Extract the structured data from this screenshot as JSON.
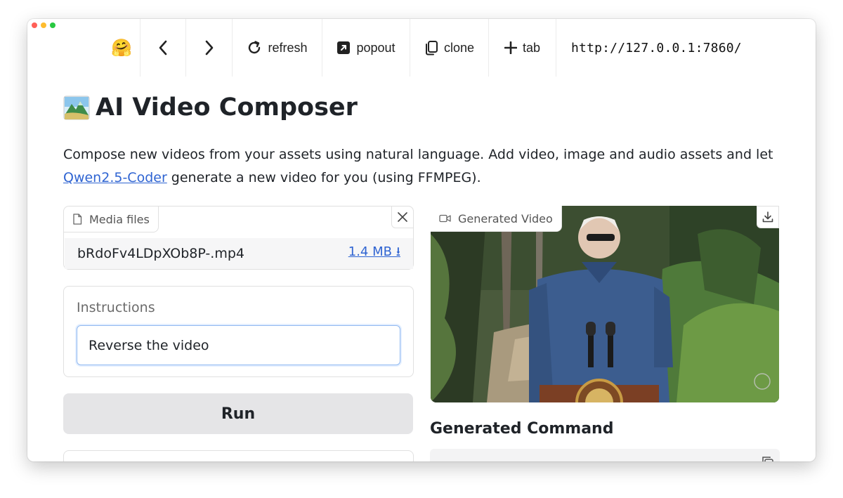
{
  "browser": {
    "window_controls": [
      "close",
      "minimize",
      "maximize"
    ],
    "toolbar": {
      "logo_emoji": "🤗",
      "back_icon": "chevron-left-icon",
      "forward_icon": "chevron-right-icon",
      "refresh_label": "refresh",
      "popout_label": "popout",
      "clone_label": "clone",
      "tab_label": "tab"
    },
    "url": "http://127.0.0.1:7860/"
  },
  "app": {
    "title_icon": "mountain-landscape-emoji",
    "title": "AI Video Composer",
    "description_prefix": "Compose new videos from your assets using natural language. Add video, image and audio assets and let ",
    "description_link": "Qwen2.5-Coder",
    "description_suffix": " generate a new video for you (using FFMPEG)."
  },
  "media_files": {
    "label": "Media files",
    "files": [
      {
        "name": "bRdoFv4LDpXOb8P-.mp4",
        "size": "1.4 MB ⭳"
      }
    ]
  },
  "instructions": {
    "label": "Instructions",
    "value": "Reverse the video"
  },
  "run_button": {
    "label": "Run"
  },
  "generated_video": {
    "label": "Generated Video"
  },
  "generated_command": {
    "heading": "Generated Command"
  },
  "colors": {
    "link": "#2f64d2",
    "run_button_bg": "#e5e5e7",
    "input_focus_border": "#8fb8f0"
  }
}
